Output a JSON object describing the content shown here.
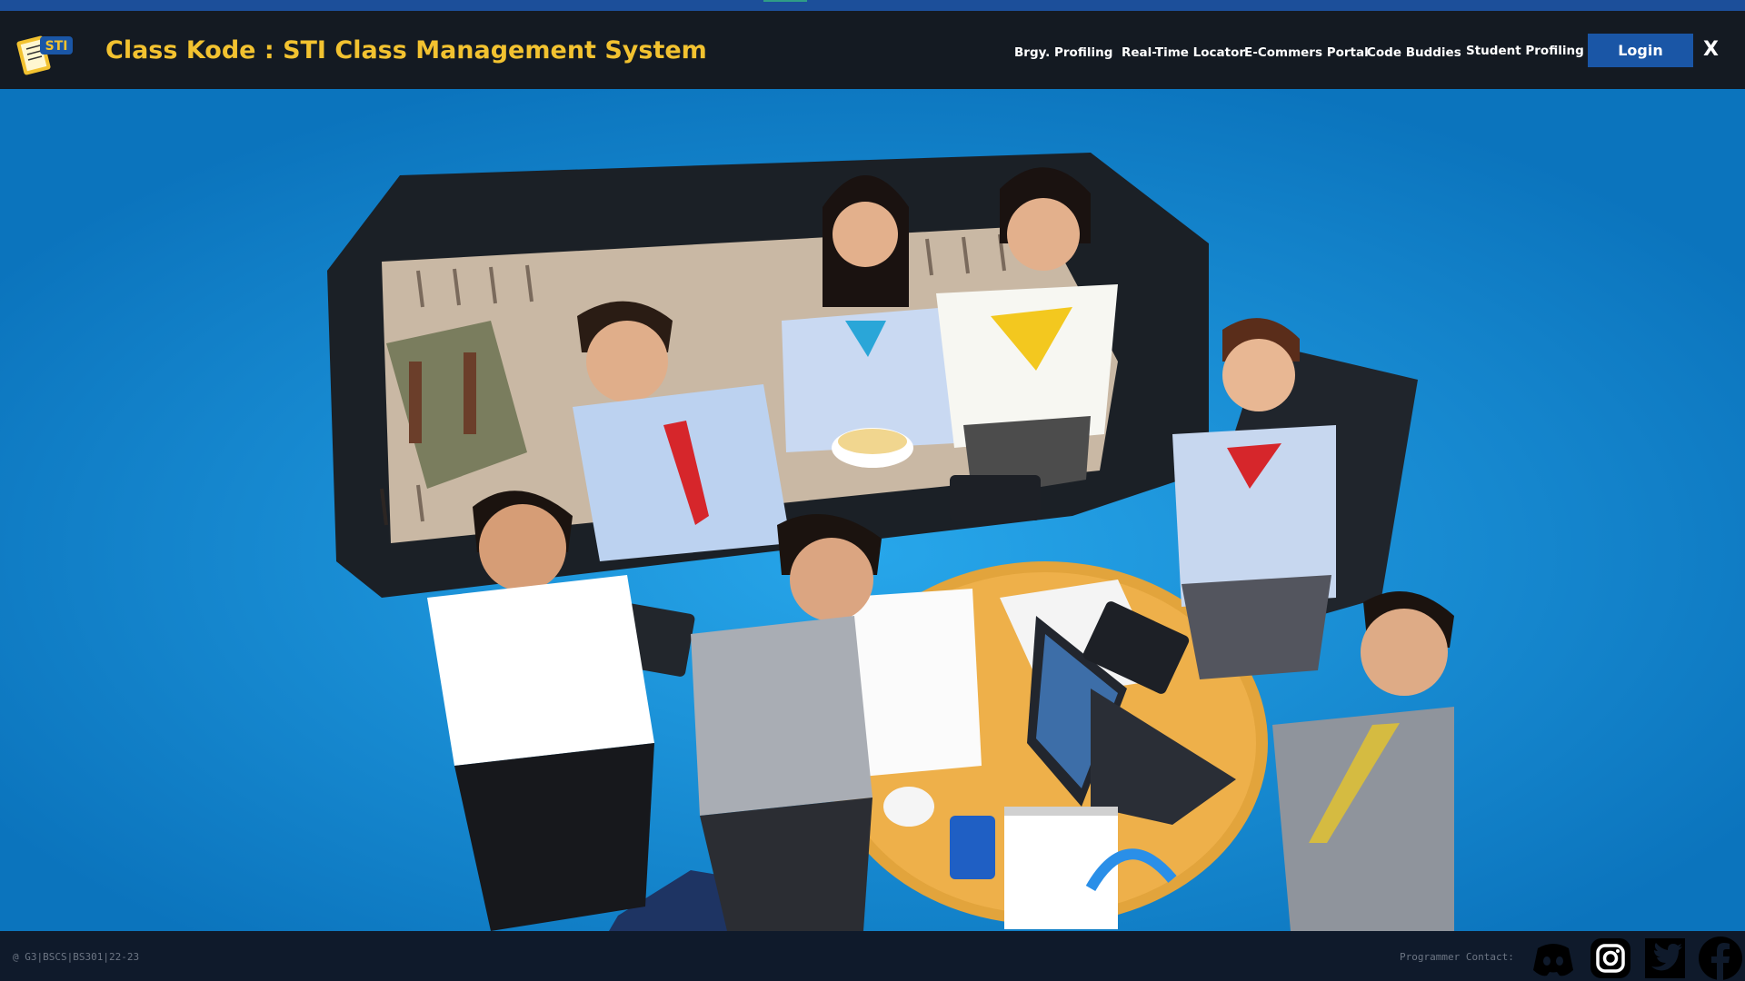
{
  "header": {
    "title": "Class Kode : STI Class Management System",
    "logo_text": "STI",
    "nav": [
      {
        "label": "Brgy. Profiling"
      },
      {
        "label": "Real-Time Locator"
      },
      {
        "label": "E-Commers Portal"
      },
      {
        "label": "Code Buddies"
      },
      {
        "label": "Student Profiling"
      }
    ],
    "login_label": "Login",
    "close_label": "X"
  },
  "hero": {
    "image_icon": "students-group-photo"
  },
  "footer": {
    "copyright": "@ G3|BSCS|BS301|22-23",
    "contact_label": "Programmer Contact:",
    "social": [
      {
        "icon": "discord-icon"
      },
      {
        "icon": "instagram-icon"
      },
      {
        "icon": "twitter-icon"
      },
      {
        "icon": "facebook-icon"
      }
    ]
  },
  "colors": {
    "title": "#f2c230",
    "navbar_bg": "#141a22",
    "login_bg": "#1a56a6",
    "hero_bg": "#138bd4",
    "footer_bg": "#0f1a2b"
  }
}
